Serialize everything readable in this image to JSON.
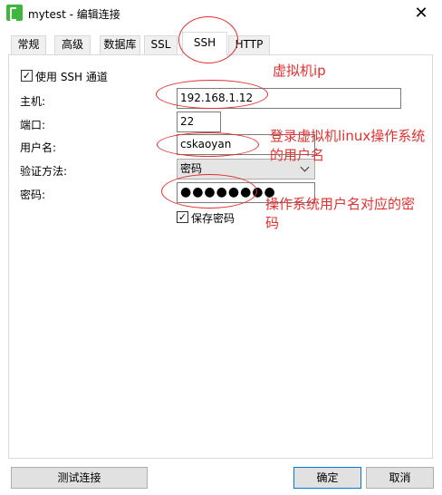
{
  "window": {
    "title": "mytest - 编辑连接",
    "close_symbol": "✕"
  },
  "tabs": [
    {
      "label": "常规"
    },
    {
      "label": "高级"
    },
    {
      "label": "数据库"
    },
    {
      "label": "SSL"
    },
    {
      "label": "SSH"
    },
    {
      "label": "HTTP"
    }
  ],
  "ssh": {
    "use_ssh_label": "使用 SSH 通道",
    "use_ssh_checked": "✓",
    "host_label": "主机:",
    "host_value": "192.168.1.12",
    "port_label": "端口:",
    "port_value": "22",
    "user_label": "用户名:",
    "user_value": "cskaoyan",
    "auth_label": "验证方法:",
    "auth_value": "密码",
    "password_label": "密码:",
    "password_value": "●●●●●●●●",
    "save_password_label": "保存密码",
    "save_password_checked": "✓"
  },
  "annotations": {
    "host_note": "虚拟机ip",
    "user_note_line1": "登录虚拟机linux操作系统",
    "user_note_line2": "的用户名",
    "password_note_line1": "操作系统用户名对应的密",
    "password_note_line2": "码",
    "color": "#e03030"
  },
  "buttons": {
    "test": "测试连接",
    "ok": "确定",
    "cancel": "取消"
  }
}
